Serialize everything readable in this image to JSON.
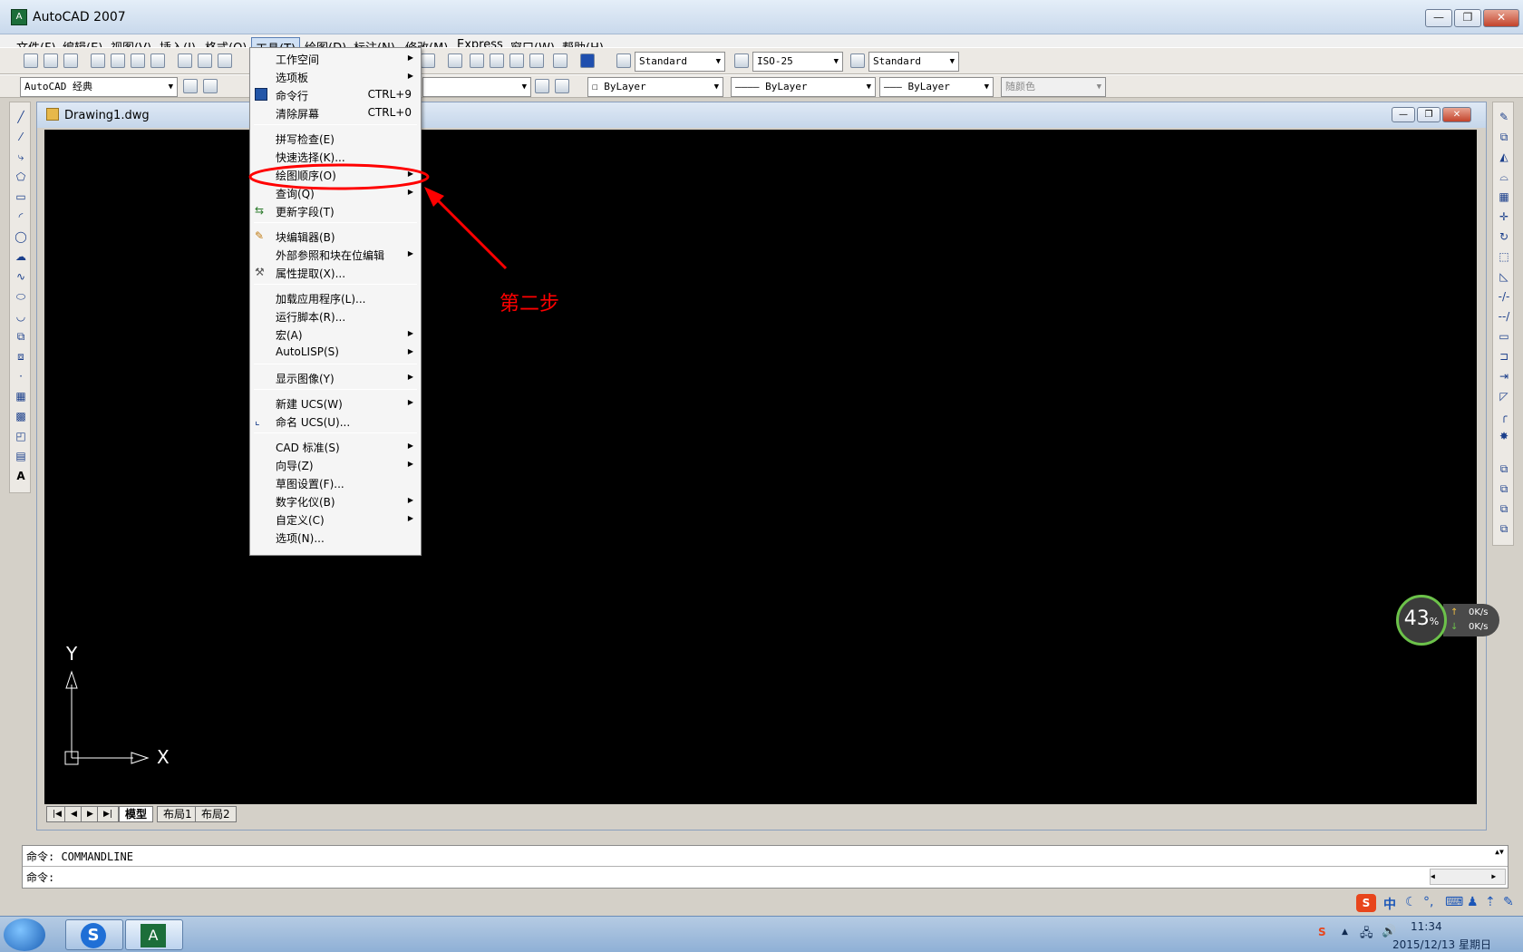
{
  "app": {
    "title": "AutoCAD 2007",
    "icon_text": "A",
    "minimize": "—",
    "maximize": "❐",
    "close": "✕"
  },
  "menubar": [
    {
      "label": "文件(F)"
    },
    {
      "label": "编辑(E)"
    },
    {
      "label": "视图(V)"
    },
    {
      "label": "插入(I)"
    },
    {
      "label": "格式(O)"
    },
    {
      "label": "工具(T)",
      "active": true
    },
    {
      "label": "绘图(D)"
    },
    {
      "label": "标注(N)"
    },
    {
      "label": "修改(M)"
    },
    {
      "label": "Express"
    },
    {
      "label": "窗口(W)"
    },
    {
      "label": "帮助(H)"
    }
  ],
  "toolbar": {
    "text_style": "Standard",
    "dim_style": "ISO-25",
    "table_style": "Standard",
    "workspace": "AutoCAD 经典",
    "layer_color": "ByLayer",
    "linetype": "ByLayer",
    "lineweight": "ByLayer",
    "plot_style": "随颜色"
  },
  "document": {
    "title": "Drawing1.dwg",
    "minimize": "—",
    "maximize": "❐",
    "close": "✕"
  },
  "ucs": {
    "x_label": "X",
    "y_label": "Y"
  },
  "layout_tabs": [
    {
      "label": "模型",
      "active": true
    },
    {
      "label": "布局1"
    },
    {
      "label": "布局2"
    }
  ],
  "tab_nav": [
    "|◀",
    "◀",
    "▶",
    "▶|"
  ],
  "tools_menu": {
    "items": [
      {
        "label": "工作空间",
        "submenu": true
      },
      {
        "label": "选项板",
        "submenu": true
      },
      {
        "label": "命令行",
        "shortcut": "CTRL+9"
      },
      {
        "label": "清除屏幕",
        "shortcut": "CTRL+0"
      },
      {
        "label": "拼写检查(E)"
      },
      {
        "label": "快速选择(K)..."
      },
      {
        "label": "绘图顺序(O)",
        "submenu": true
      },
      {
        "label": "查询(Q)",
        "submenu": true
      },
      {
        "label": "更新字段(T)"
      },
      {
        "label": "块编辑器(B)"
      },
      {
        "label": "外部参照和块在位编辑",
        "submenu": true
      },
      {
        "label": "属性提取(X)..."
      },
      {
        "label": "加载应用程序(L)..."
      },
      {
        "label": "运行脚本(R)..."
      },
      {
        "label": "宏(A)",
        "submenu": true
      },
      {
        "label": "AutoLISP(S)",
        "submenu": true
      },
      {
        "label": "显示图像(Y)",
        "submenu": true
      },
      {
        "label": "新建 UCS(W)",
        "submenu": true
      },
      {
        "label": "命名 UCS(U)..."
      },
      {
        "label": "CAD 标准(S)",
        "submenu": true
      },
      {
        "label": "向导(Z)",
        "submenu": true
      },
      {
        "label": "草图设置(F)..."
      },
      {
        "label": "数字化仪(B)",
        "submenu": true
      },
      {
        "label": "自定义(C)",
        "submenu": true
      },
      {
        "label": "选项(N)..."
      }
    ]
  },
  "annotation": {
    "step_label": "第二步",
    "color": "#ff0000"
  },
  "command": {
    "line1": "命令: COMMANDLINE",
    "line2": "命令:"
  },
  "speed_widget": {
    "percent": "43",
    "unit": "%",
    "up": "0K/s",
    "down": "0K/s"
  },
  "taskbar": {
    "time": "11:34",
    "date": "2015/12/13 星期日"
  },
  "ime": {
    "s": "S",
    "lang": "中"
  }
}
